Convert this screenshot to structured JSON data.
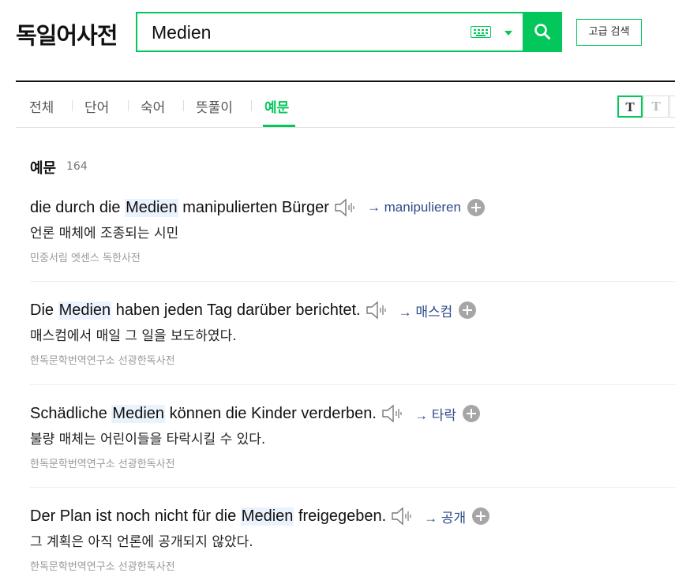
{
  "header": {
    "logo": "독일어사전",
    "search_value": "Medien",
    "keyboard_icon": "keyboard-icon",
    "dropdown_icon": "caret-down-icon",
    "search_icon": "magnifier-icon",
    "advanced_label": "고급 검색"
  },
  "tabs": [
    {
      "label": "전체",
      "active": false
    },
    {
      "label": "단어",
      "active": false
    },
    {
      "label": "숙어",
      "active": false
    },
    {
      "label": "뜻풀이",
      "active": false
    },
    {
      "label": "예문",
      "active": true
    }
  ],
  "font_toggles": [
    "T",
    "T"
  ],
  "section": {
    "title": "예문",
    "count": "164"
  },
  "examples": [
    {
      "before": "die durch die ",
      "highlight": "Medien",
      "after": " manipulierten Bürger",
      "link": "→ manipulieren",
      "translation": "언론 매체에 조종되는 시민",
      "source": "민중서림 엣센스 독한사전"
    },
    {
      "before": "Die ",
      "highlight": "Medien",
      "after": " haben jeden Tag darüber berichtet.",
      "link": "→ 매스컴",
      "translation": "매스컴에서 매일 그 일을 보도하였다.",
      "source": "한독문학번역연구소 선광한독사전"
    },
    {
      "before": "Schädliche ",
      "highlight": "Medien",
      "after": " können die Kinder verderben.",
      "link": "→ 타락",
      "translation": "불량 매체는 어린이들을 타락시킬 수 있다.",
      "source": "한독문학번역연구소 선광한독사전"
    },
    {
      "before": "Der Plan ist noch nicht für die ",
      "highlight": "Medien",
      "after": " freigegeben.",
      "link": "→ 공개",
      "translation": "그 계획은 아직 언론에 공개되지 않았다.",
      "source": "한독문학번역연구소 선광한독사전"
    }
  ],
  "colors": {
    "accent": "#03c75a",
    "highlight": "#eaf3fd",
    "link": "#2e4b8b"
  }
}
